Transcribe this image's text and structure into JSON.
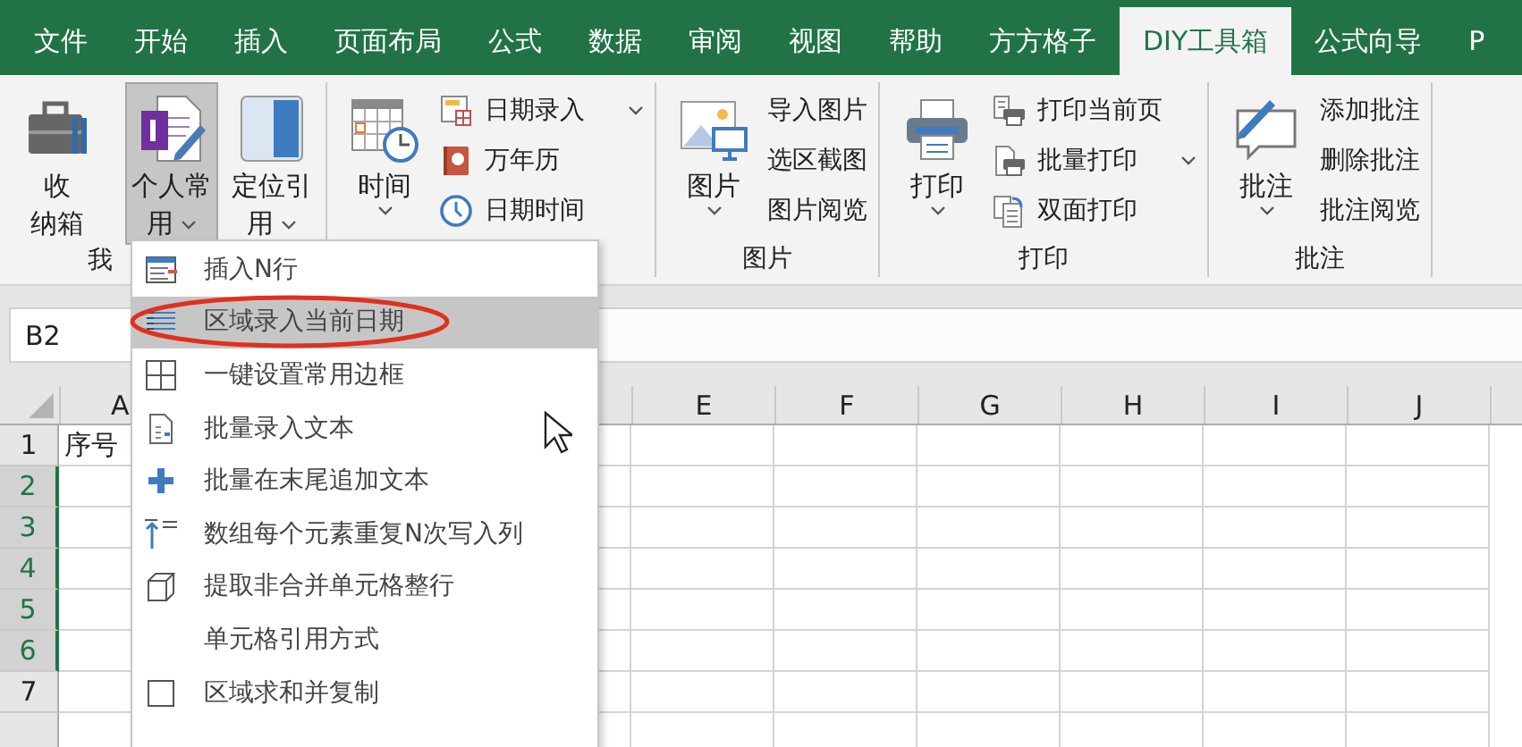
{
  "tabs": [
    {
      "label": "文件",
      "selected": false
    },
    {
      "label": "开始",
      "selected": false
    },
    {
      "label": "插入",
      "selected": false
    },
    {
      "label": "页面布局",
      "selected": false
    },
    {
      "label": "公式",
      "selected": false
    },
    {
      "label": "数据",
      "selected": false
    },
    {
      "label": "审阅",
      "selected": false
    },
    {
      "label": "视图",
      "selected": false
    },
    {
      "label": "帮助",
      "selected": false
    },
    {
      "label": "方方格子",
      "selected": false
    },
    {
      "label": "DIY工具箱",
      "selected": true
    },
    {
      "label": "公式向导",
      "selected": false
    },
    {
      "label": "P",
      "selected": false
    }
  ],
  "ribbon": {
    "groups": [
      {
        "label": "我",
        "large": [
          {
            "lines": [
              "收",
              "纳箱"
            ],
            "dropdown": false,
            "pressed": false
          },
          {
            "lines": [
              "个人常",
              "用"
            ],
            "dropdown": true,
            "pressed": true
          },
          {
            "lines": [
              "定位引",
              "用"
            ],
            "dropdown": true,
            "pressed": false
          }
        ]
      },
      {
        "large": [
          {
            "lines": [
              "时间"
            ],
            "dropdown": true,
            "pressed": false
          }
        ],
        "small": [
          {
            "label": "日期录入",
            "dropdown": true
          },
          {
            "label": "万年历",
            "dropdown": false
          },
          {
            "label": "日期时间",
            "dropdown": false
          }
        ]
      },
      {
        "label": "图片",
        "large": [
          {
            "lines": [
              "图片"
            ],
            "dropdown": true,
            "pressed": false
          }
        ],
        "small": [
          {
            "label": "导入图片",
            "dropdown": false
          },
          {
            "label": "选区截图",
            "dropdown": false
          },
          {
            "label": "图片阅览",
            "dropdown": false
          }
        ]
      },
      {
        "label": "打印",
        "large": [
          {
            "lines": [
              "打印"
            ],
            "dropdown": true,
            "pressed": false
          }
        ],
        "small": [
          {
            "label": "打印当前页",
            "dropdown": false
          },
          {
            "label": "批量打印",
            "dropdown": true
          },
          {
            "label": "双面打印",
            "dropdown": false
          }
        ]
      },
      {
        "label": "批注",
        "large": [
          {
            "lines": [
              "批注"
            ],
            "dropdown": true,
            "pressed": false
          }
        ],
        "small": [
          {
            "label": "添加批注",
            "dropdown": false
          },
          {
            "label": "删除批注",
            "dropdown": false
          },
          {
            "label": "批注阅览",
            "dropdown": false
          }
        ]
      }
    ]
  },
  "name_box": {
    "value": "B2"
  },
  "sheet": {
    "columns": [
      "A",
      "E",
      "F",
      "G",
      "H",
      "I",
      "J"
    ],
    "rows": [
      {
        "number": "1",
        "selected": false,
        "cells": [
          "序号"
        ]
      },
      {
        "number": "2",
        "selected": true
      },
      {
        "number": "3",
        "selected": true
      },
      {
        "number": "4",
        "selected": true
      },
      {
        "number": "5",
        "selected": true
      },
      {
        "number": "6",
        "selected": true
      },
      {
        "number": "7",
        "selected": false
      }
    ]
  },
  "menu": {
    "items": [
      {
        "label": "插入N行",
        "selected": false
      },
      {
        "label": "区域录入当前日期",
        "selected": true
      },
      {
        "label": "一键设置常用边框",
        "selected": false
      },
      {
        "label": "批量录入文本",
        "selected": false
      },
      {
        "label": "批量在末尾追加文本",
        "selected": false
      },
      {
        "label": "数组每个元素重复N次写入列",
        "selected": false
      },
      {
        "label": "提取非合并单元格整行",
        "selected": false
      },
      {
        "label": "单元格引用方式",
        "selected": false
      },
      {
        "label": "区域求和并复制",
        "selected": false
      }
    ]
  }
}
